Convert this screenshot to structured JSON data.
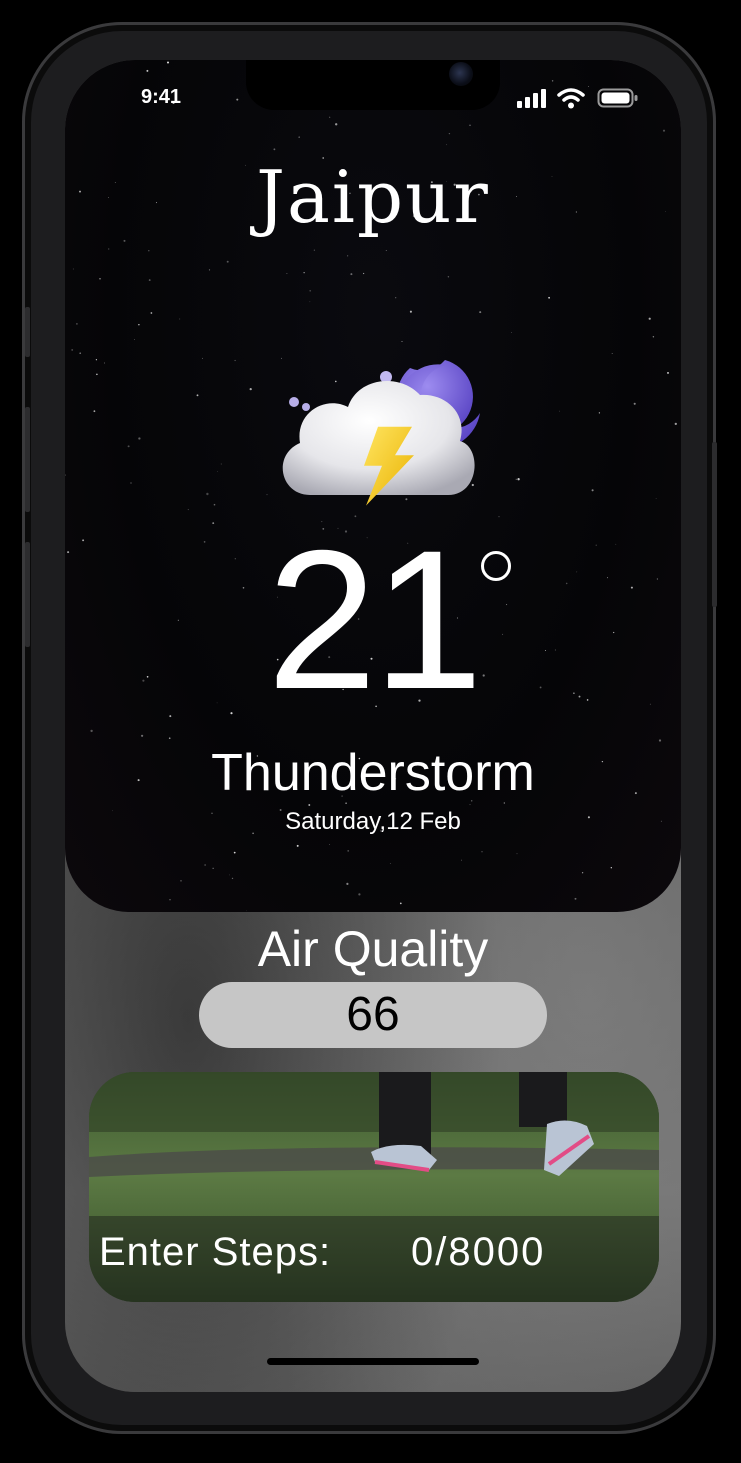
{
  "status_bar": {
    "time": "9:41",
    "icons": [
      "cellular-signal-icon",
      "wifi-icon",
      "battery-icon"
    ]
  },
  "weather": {
    "city": "Jaipur",
    "icon": "thunderstorm-night-icon",
    "temperature": "21",
    "condition": "Thunderstorm",
    "date": "Saturday,12 Feb"
  },
  "air_quality": {
    "title": "Air Quality",
    "value": "66"
  },
  "steps": {
    "label": "Enter Steps:",
    "value": "0/8000"
  },
  "colors": {
    "card_background": "#050507",
    "aq_pill": "#c6c6c6",
    "moon": "#7b68d9",
    "lightning": "#f6d22e"
  }
}
